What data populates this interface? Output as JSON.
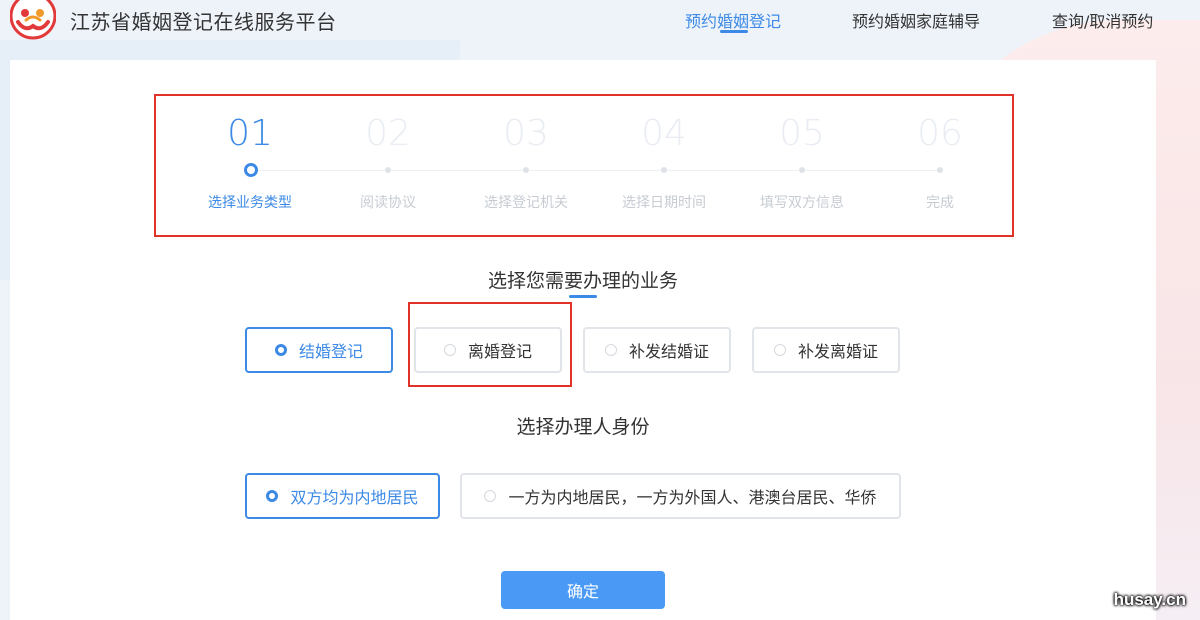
{
  "header": {
    "site_title": "江苏省婚姻登记在线服务平台",
    "nav": [
      {
        "label": "预约婚姻登记",
        "active": true
      },
      {
        "label": "预约婚姻家庭辅导",
        "active": false
      },
      {
        "label": "查询/取消预约",
        "active": false
      }
    ]
  },
  "steps": [
    {
      "num": "01",
      "label": "选择业务类型",
      "active": true
    },
    {
      "num": "02",
      "label": "阅读协议",
      "active": false
    },
    {
      "num": "03",
      "label": "选择登记机关",
      "active": false
    },
    {
      "num": "04",
      "label": "选择日期时间",
      "active": false
    },
    {
      "num": "05",
      "label": "填写双方信息",
      "active": false
    },
    {
      "num": "06",
      "label": "完成",
      "active": false
    }
  ],
  "business": {
    "title": "选择您需要办理的业务",
    "options": [
      {
        "label": "结婚登记",
        "selected": true
      },
      {
        "label": "离婚登记",
        "selected": false
      },
      {
        "label": "补发结婚证",
        "selected": false
      },
      {
        "label": "补发离婚证",
        "selected": false
      }
    ]
  },
  "identity": {
    "title": "选择办理人身份",
    "options": [
      {
        "label": "双方均为内地居民",
        "selected": true
      },
      {
        "label": "一方为内地居民，一方为外国人、港澳台居民、华侨",
        "selected": false
      }
    ]
  },
  "confirm_label": "确定",
  "watermark": "husay.cn",
  "colors": {
    "accent": "#3c8ae6",
    "annotation": "#e1322a"
  }
}
